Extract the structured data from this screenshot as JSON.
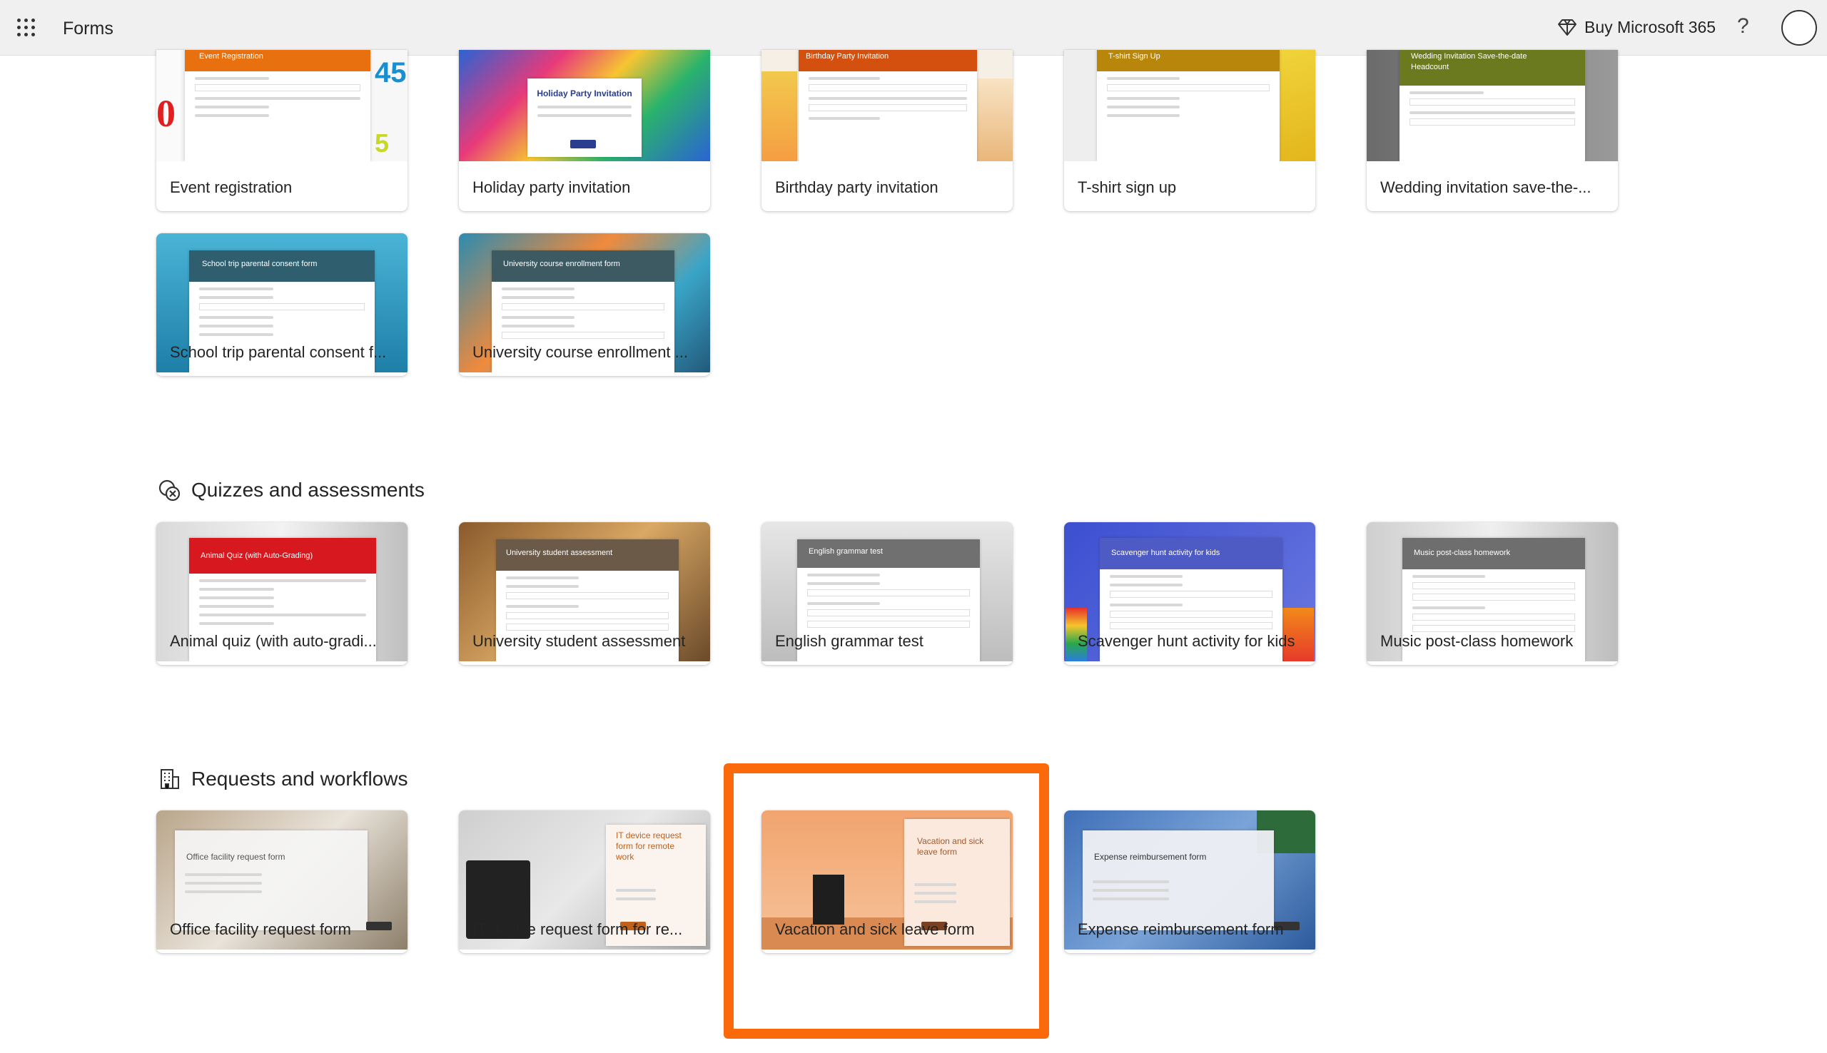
{
  "header": {
    "app_title": "Forms",
    "buy_label": "Buy Microsoft 365",
    "help_label": "?"
  },
  "sections": {
    "quizzes_title": "Quizzes and assessments",
    "requests_title": "Requests and workflows"
  },
  "cards": {
    "event_registration": {
      "label": "Event registration",
      "thumb_title": "Event Registration"
    },
    "holiday_party": {
      "label": "Holiday party invitation",
      "thumb_title": "Holiday Party Invitation"
    },
    "birthday_party": {
      "label": "Birthday party invitation",
      "thumb_title": "Birthday Party Invitation"
    },
    "tshirt": {
      "label": "T-shirt sign up",
      "thumb_title": "T-shirt Sign Up"
    },
    "wedding": {
      "label": "Wedding invitation save-the-...",
      "thumb_title": "Wedding Invitation Save-the-date Headcount"
    },
    "school_trip": {
      "label": "School trip parental consent f...",
      "thumb_title": "School trip parental consent form"
    },
    "university_course": {
      "label": "University course enrollment ...",
      "thumb_title": "University course enrollment form"
    },
    "animal_quiz": {
      "label": "Animal quiz (with auto-gradi...",
      "thumb_title": "Animal Quiz (with Auto-Grading)"
    },
    "university_assessment": {
      "label": "University student assessment",
      "thumb_title": "University student assessment"
    },
    "english_grammar": {
      "label": "English grammar test",
      "thumb_title": "English grammar test"
    },
    "scavenger": {
      "label": "Scavenger hunt activity for kids",
      "thumb_title": "Scavenger hunt activity for kids"
    },
    "music": {
      "label": "Music post-class homework",
      "thumb_title": "Music post-class homework"
    },
    "office_facility": {
      "label": "Office facility request form",
      "thumb_title": "Office facility request form"
    },
    "it_device": {
      "label": "IT device request form for re...",
      "thumb_title": "IT device request form for remote work"
    },
    "vacation": {
      "label": "Vacation and sick leave form",
      "thumb_title": "Vacation and sick leave form"
    },
    "expense": {
      "label": "Expense reimbursement form",
      "thumb_title": "Expense reimbursement form"
    }
  },
  "colors": {
    "highlight": "#fa6a0a",
    "event_header": "#e8700f",
    "birthday_header": "#d4500e",
    "tshirt_header": "#b8860b",
    "wedding_header": "#6b7a1f",
    "school_header": "#2f5f6f",
    "university_header": "#3d5a62",
    "animal_header": "#d7181f",
    "assessment_header": "#6b5a48",
    "grammar_header": "#707070",
    "scavenger_header": "#4f5bc4",
    "music_header": "#6e6e6e"
  }
}
